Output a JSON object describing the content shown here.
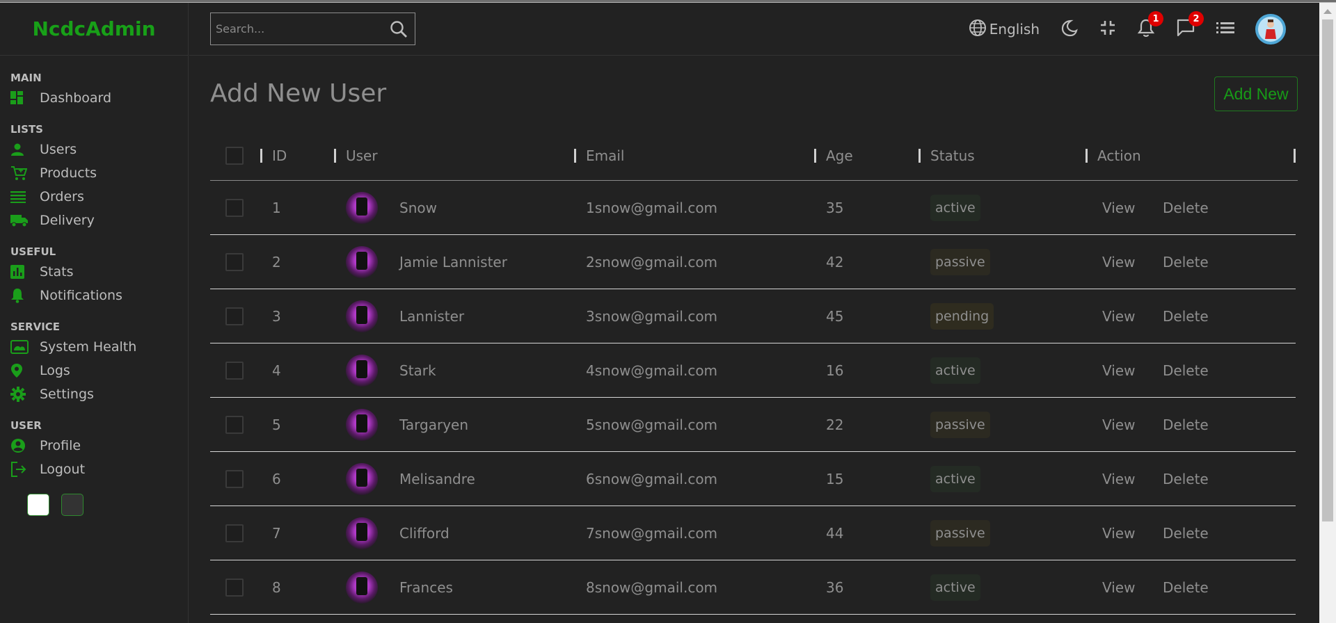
{
  "sidebar": {
    "logo": "NcdcAdmin",
    "sections": [
      {
        "title": "MAIN",
        "items": [
          {
            "label": "Dashboard",
            "icon": "dashboard-icon"
          }
        ]
      },
      {
        "title": "LISTS",
        "items": [
          {
            "label": "Users",
            "icon": "person-icon"
          },
          {
            "label": "Products",
            "icon": "cart-icon"
          },
          {
            "label": "Orders",
            "icon": "list-icon"
          },
          {
            "label": "Delivery",
            "icon": "truck-icon"
          }
        ]
      },
      {
        "title": "USEFUL",
        "items": [
          {
            "label": "Stats",
            "icon": "bar-chart-icon"
          },
          {
            "label": "Notifications",
            "icon": "bell-icon"
          }
        ]
      },
      {
        "title": "SERVICE",
        "items": [
          {
            "label": "System Health",
            "icon": "health-icon"
          },
          {
            "label": "Logs",
            "icon": "location-pin-icon"
          },
          {
            "label": "Settings",
            "icon": "gear-icon"
          }
        ]
      },
      {
        "title": "USER",
        "items": [
          {
            "label": "Profile",
            "icon": "account-circle-icon"
          },
          {
            "label": "Logout",
            "icon": "logout-icon"
          }
        ]
      }
    ]
  },
  "navbar": {
    "search_placeholder": "Search...",
    "language": "English",
    "notifications_count": "1",
    "messages_count": "2"
  },
  "page": {
    "title": "Add New User",
    "add_button": "Add New"
  },
  "table": {
    "headers": {
      "id": "ID",
      "user": "User",
      "email": "Email",
      "age": "Age",
      "status": "Status",
      "action": "Action"
    },
    "view_label": "View",
    "delete_label": "Delete",
    "rows": [
      {
        "id": "1",
        "user": "Snow",
        "email": "1snow@gmail.com",
        "age": "35",
        "status": "active"
      },
      {
        "id": "2",
        "user": "Jamie Lannister",
        "email": "2snow@gmail.com",
        "age": "42",
        "status": "passive"
      },
      {
        "id": "3",
        "user": "Lannister",
        "email": "3snow@gmail.com",
        "age": "45",
        "status": "pending"
      },
      {
        "id": "4",
        "user": "Stark",
        "email": "4snow@gmail.com",
        "age": "16",
        "status": "active"
      },
      {
        "id": "5",
        "user": "Targaryen",
        "email": "5snow@gmail.com",
        "age": "22",
        "status": "passive"
      },
      {
        "id": "6",
        "user": "Melisandre",
        "email": "6snow@gmail.com",
        "age": "15",
        "status": "active"
      },
      {
        "id": "7",
        "user": "Clifford",
        "email": "7snow@gmail.com",
        "age": "44",
        "status": "passive"
      },
      {
        "id": "8",
        "user": "Frances",
        "email": "8snow@gmail.com",
        "age": "36",
        "status": "active"
      }
    ]
  },
  "colors": {
    "background": "#222222",
    "accent": "#18a018",
    "text": "#9a9a9a",
    "badge": "#e00000"
  }
}
